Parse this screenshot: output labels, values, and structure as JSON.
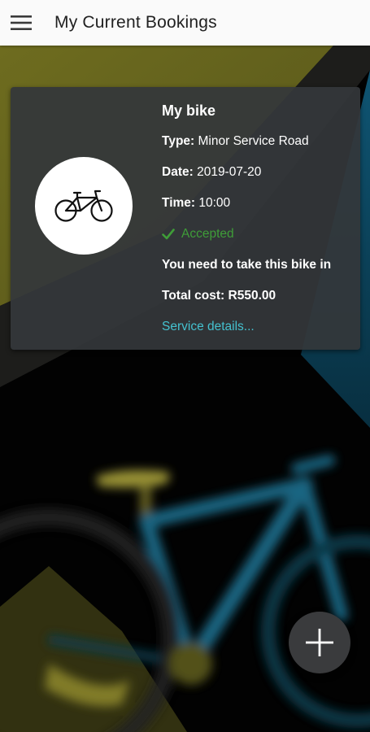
{
  "app_bar": {
    "title": "My Current Bookings",
    "menu_icon": "hamburger-menu-icon"
  },
  "booking": {
    "bike_name": "My bike",
    "type_label": "Type:",
    "type_value": "Minor Service Road",
    "date_label": "Date:",
    "date_value": "2019-07-20",
    "time_label": "Time:",
    "time_value": "10:00",
    "status": "Accepted",
    "status_icon": "checkmark-icon",
    "instruction": "You need to take this bike in",
    "total_label": "Total cost:",
    "total_value": "R550.00",
    "details_link": "Service details...",
    "avatar_icon": "bicycle-icon"
  },
  "fab": {
    "icon": "plus-icon"
  },
  "colors": {
    "accent_link": "#44c1cf",
    "status_accepted": "#3f9d38",
    "card_bg": "#34373a",
    "bg_yellow": "#6b6a1e",
    "bg_blue": "#0d4a63"
  }
}
